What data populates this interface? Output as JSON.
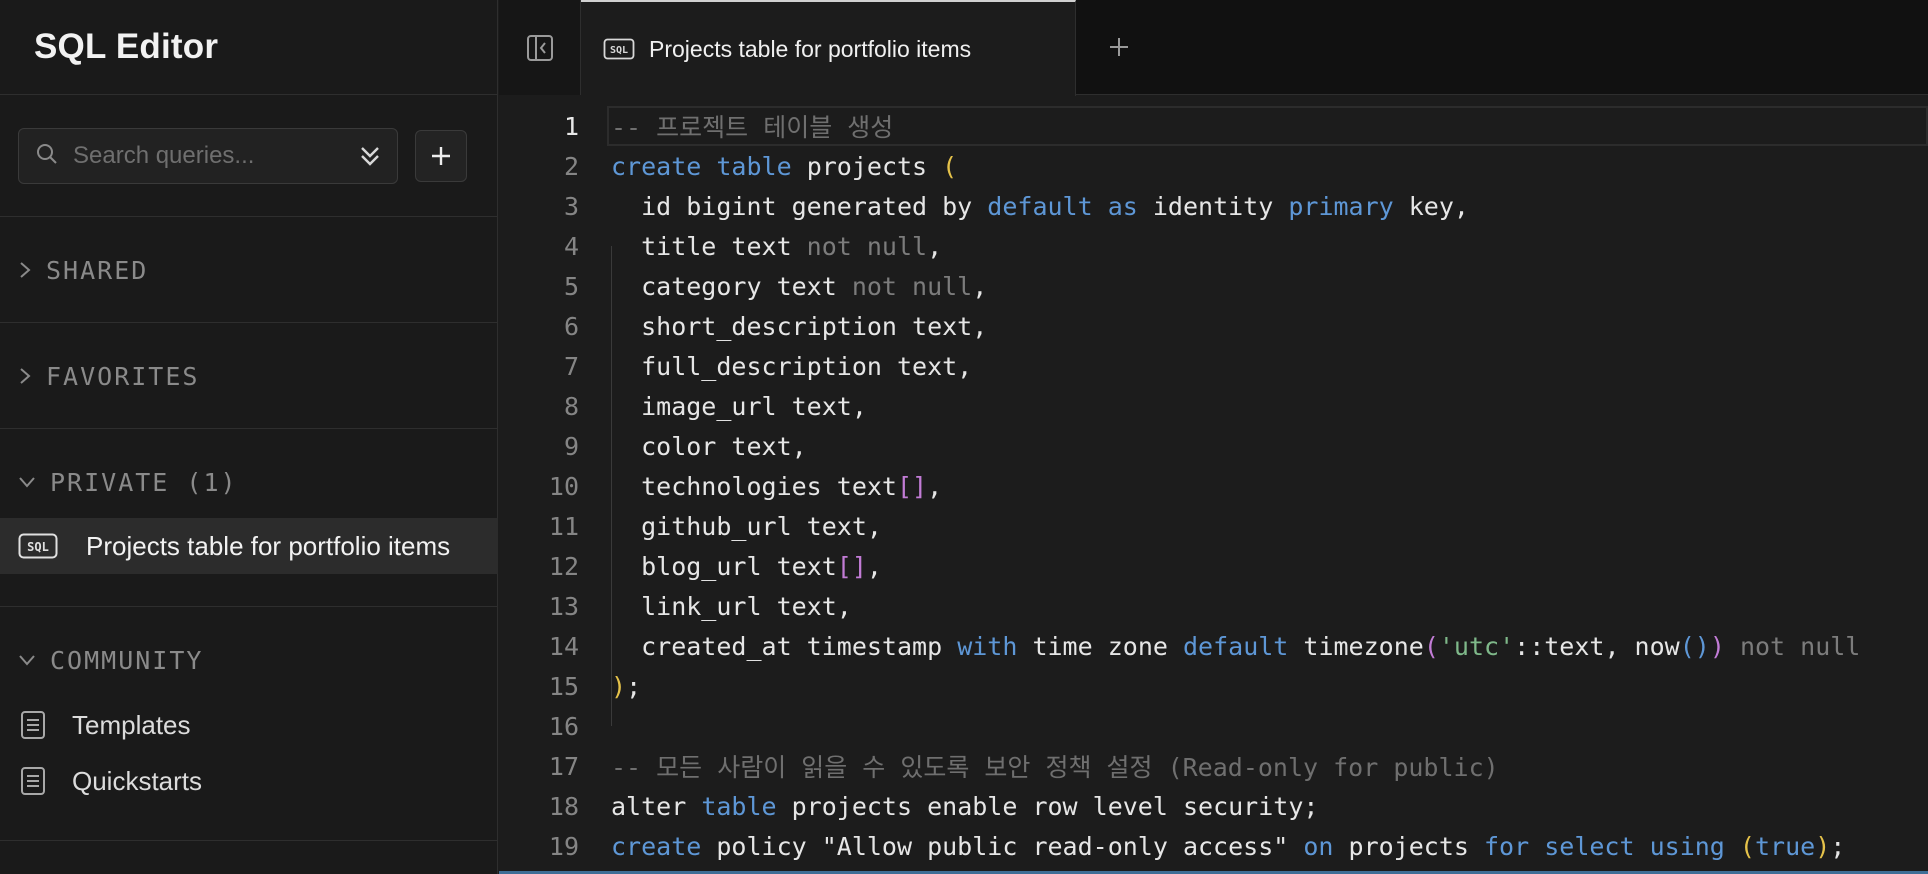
{
  "sidebar": {
    "title": "SQL Editor",
    "search_placeholder": "Search queries...",
    "sections": {
      "shared": "SHARED",
      "favorites": "FAVORITES",
      "private": "PRIVATE (1)",
      "community": "COMMUNITY"
    },
    "private_item": "Projects table for portfolio items",
    "community_items": [
      "Templates",
      "Quickstarts"
    ]
  },
  "tabs": {
    "active_label": "Projects table for portfolio items"
  },
  "editor": {
    "line_numbers": [
      "1",
      "2",
      "3",
      "4",
      "5",
      "6",
      "7",
      "8",
      "9",
      "10",
      "11",
      "12",
      "13",
      "14",
      "15",
      "16",
      "17",
      "18",
      "19"
    ],
    "lines": [
      "-- 프로젝트 테이블 생성",
      "create table projects (",
      "  id bigint generated by default as identity primary key,",
      "  title text not null,",
      "  category text not null,",
      "  short_description text,",
      "  full_description text,",
      "  image_url text,",
      "  color text,",
      "  technologies text[],",
      "  github_url text,",
      "  blog_url text[],",
      "  link_url text,",
      "  created_at timestamp with time zone default timezone('utc'::text, now()) not null",
      ");",
      "",
      "-- 모든 사람이 읽을 수 있도록 보안 정책 설정 (Read-only for public)",
      "alter table projects enable row level security;",
      "create policy \"Allow public read-only access\" on projects for select using (true);"
    ]
  },
  "colors": {
    "keyword": "#5e97d6",
    "comment": "#6f6f6f",
    "string": "#7fb98a",
    "bracket": "#c27cd6",
    "paren": "#e5c24a"
  }
}
